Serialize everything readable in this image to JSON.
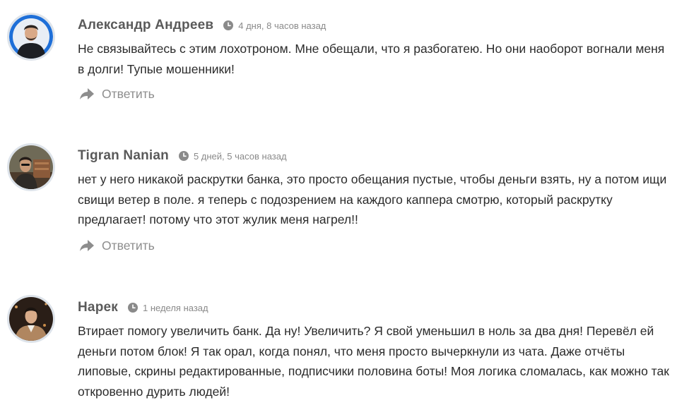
{
  "comments": [
    {
      "author": "Александр Андреев",
      "time": "4 дня, 8 часов назад",
      "text": "Не связывайтесь с этим лохотроном. Мне обещали, что я разбогатею. Но они наоборот вогнали меня в долги! Тупые мошенники!",
      "reply_label": "Ответить"
    },
    {
      "author": "Tigran Nanian",
      "time": "5 дней, 5 часов назад",
      "text": "нет у него никакой раскрутки банка, это просто обещания пустые, чтобы деньги взять, ну а потом ищи свищи ветер в поле. я теперь с подозрением на каждого каппера смотрю, который раскрутку предлагает! потому что этот жулик меня нагрел!!",
      "reply_label": "Ответить"
    },
    {
      "author": "Нарек",
      "time": "1 неделя назад",
      "text": "Втирает помогу увеличить банк. Да ну! Увеличить? Я свой уменьшил в ноль за два дня! Перевёл ей деньги потом блок! Я так орал, когда понял, что меня просто вычеркнули из чата. Даже отчёты липовые, скрины редактированные, подписчики половина боты! Моя логика сломалась, как можно так откровенно дурить людей!"
    }
  ],
  "colors": {
    "author": "#5a5a5a",
    "meta": "#8a8a8a",
    "body_text": "#2b2b2b",
    "reply": "#8d8d8d",
    "avatar_border": "#dde3ea"
  },
  "icons": {
    "time": "clock-icon",
    "reply": "reply-arrow-icon"
  }
}
